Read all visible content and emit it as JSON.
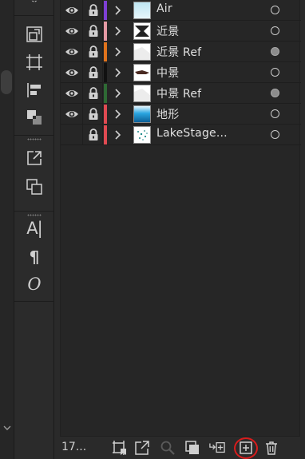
{
  "panel": {
    "layer_count": "17...",
    "layers": [
      {
        "name": "Air",
        "color": "#7e3fd4",
        "visible": true,
        "locked": true,
        "target_filled": false,
        "thumb": "sky"
      },
      {
        "name": "近景",
        "color": "#e59aa4",
        "visible": true,
        "locked": true,
        "target_filled": false,
        "thumb": "dark-shape"
      },
      {
        "name": "近景 Ref",
        "color": "#e0731c",
        "visible": true,
        "locked": true,
        "target_filled": true,
        "thumb": "light-shape"
      },
      {
        "name": "中景",
        "color": "#111111",
        "visible": true,
        "locked": true,
        "target_filled": false,
        "thumb": "mid-shape"
      },
      {
        "name": "中景 Ref",
        "color": "#2e6a34",
        "visible": true,
        "locked": true,
        "target_filled": true,
        "thumb": "light-shape"
      },
      {
        "name": "地形",
        "color": "#e04a52",
        "visible": true,
        "locked": true,
        "target_filled": false,
        "thumb": "water"
      },
      {
        "name": "LakeStage...",
        "color": "#e04a52",
        "visible": false,
        "locked": true,
        "target_filled": false,
        "thumb": "map"
      }
    ]
  },
  "tools": {
    "type_label": "A|",
    "paragraph_label": "¶",
    "glyph_label": "O"
  },
  "bottom_bar": {
    "buttons": [
      "collect-for-export-icon",
      "export-icon",
      "locate-object-icon",
      "make-clipping-mask-icon",
      "create-sublayer-icon",
      "create-new-layer-icon",
      "delete-layer-icon"
    ],
    "highlight_color": "#d81c1c"
  }
}
